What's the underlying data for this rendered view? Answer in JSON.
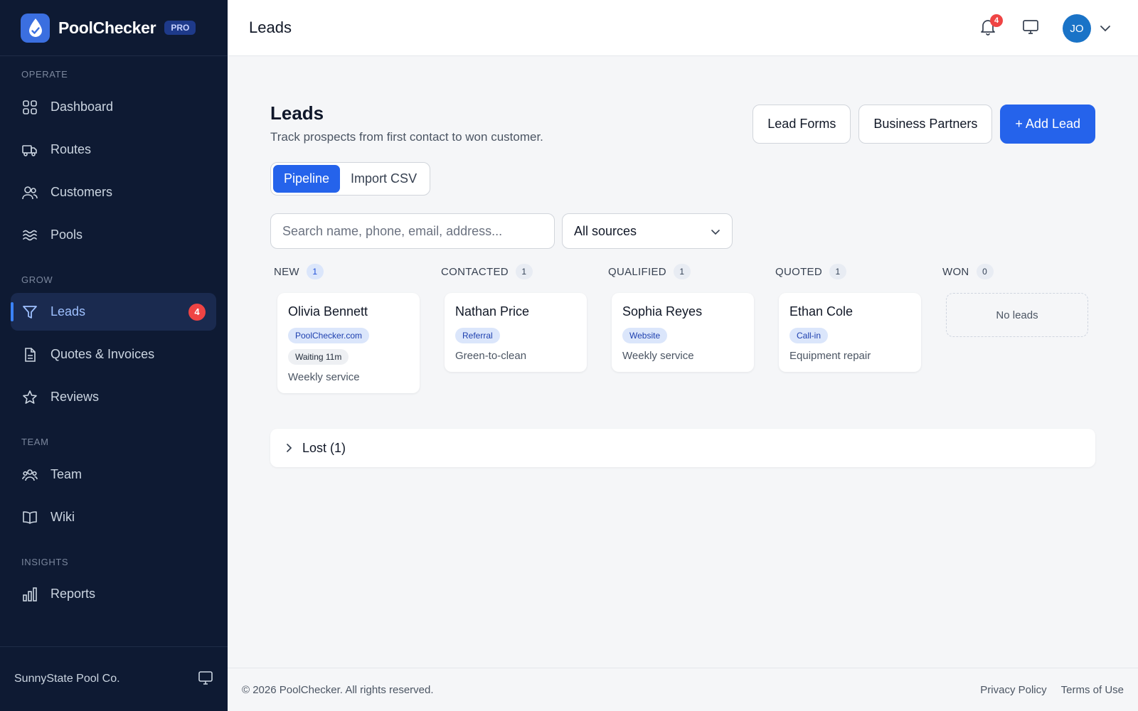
{
  "brand": {
    "name": "PoolChecker",
    "badge": "PRO"
  },
  "sidebar": {
    "sections": [
      {
        "label": "OPERATE",
        "items": [
          {
            "label": "Dashboard",
            "icon": "dashboard-icon"
          },
          {
            "label": "Routes",
            "icon": "truck-icon"
          },
          {
            "label": "Customers",
            "icon": "users-icon"
          },
          {
            "label": "Pools",
            "icon": "waves-icon"
          }
        ]
      },
      {
        "label": "GROW",
        "items": [
          {
            "label": "Leads",
            "icon": "funnel-icon",
            "badge": "4",
            "active": true
          },
          {
            "label": "Quotes & Invoices",
            "icon": "document-icon"
          },
          {
            "label": "Reviews",
            "icon": "star-icon"
          }
        ]
      },
      {
        "label": "TEAM",
        "items": [
          {
            "label": "Team",
            "icon": "team-icon"
          },
          {
            "label": "Wiki",
            "icon": "book-icon"
          }
        ]
      },
      {
        "label": "INSIGHTS",
        "items": [
          {
            "label": "Reports",
            "icon": "bar-chart-icon"
          }
        ]
      }
    ],
    "footer": {
      "company": "SunnyState Pool Co."
    }
  },
  "topbar": {
    "title": "Leads",
    "notification_count": "4",
    "avatar_initials": "JO"
  },
  "page": {
    "title": "Leads",
    "subtitle": "Track prospects from first contact to won customer.",
    "buttons": {
      "lead_forms": "Lead Forms",
      "business_partners": "Business Partners",
      "add_lead": "+ Add Lead"
    },
    "tabs": {
      "pipeline": "Pipeline",
      "import_csv": "Import CSV"
    },
    "search": {
      "placeholder": "Search name, phone, email, address..."
    },
    "source_filter": {
      "selected": "All sources"
    },
    "columns": [
      {
        "title": "NEW",
        "count": "1",
        "cards": [
          {
            "name": "Olivia Bennett",
            "source": "PoolChecker.com",
            "status": "Waiting 11m",
            "service": "Weekly service"
          }
        ]
      },
      {
        "title": "CONTACTED",
        "count": "1",
        "cards": [
          {
            "name": "Nathan Price",
            "source": "Referral",
            "service": "Green-to-clean"
          }
        ]
      },
      {
        "title": "QUALIFIED",
        "count": "1",
        "cards": [
          {
            "name": "Sophia Reyes",
            "source": "Website",
            "service": "Weekly service"
          }
        ]
      },
      {
        "title": "QUOTED",
        "count": "1",
        "cards": [
          {
            "name": "Ethan Cole",
            "source": "Call-in",
            "service": "Equipment repair"
          }
        ]
      },
      {
        "title": "WON",
        "count": "0",
        "empty_text": "No leads"
      }
    ],
    "lost": {
      "label": "Lost (1)"
    }
  },
  "footer": {
    "copyright": "© 2026 PoolChecker. All rights reserved.",
    "privacy": "Privacy Policy",
    "terms": "Terms of Use"
  },
  "colors": {
    "sidebar_bg": "#0e1a33",
    "accent": "#2563eb",
    "badge": "#ef4444",
    "avatar": "#1a73c7"
  }
}
